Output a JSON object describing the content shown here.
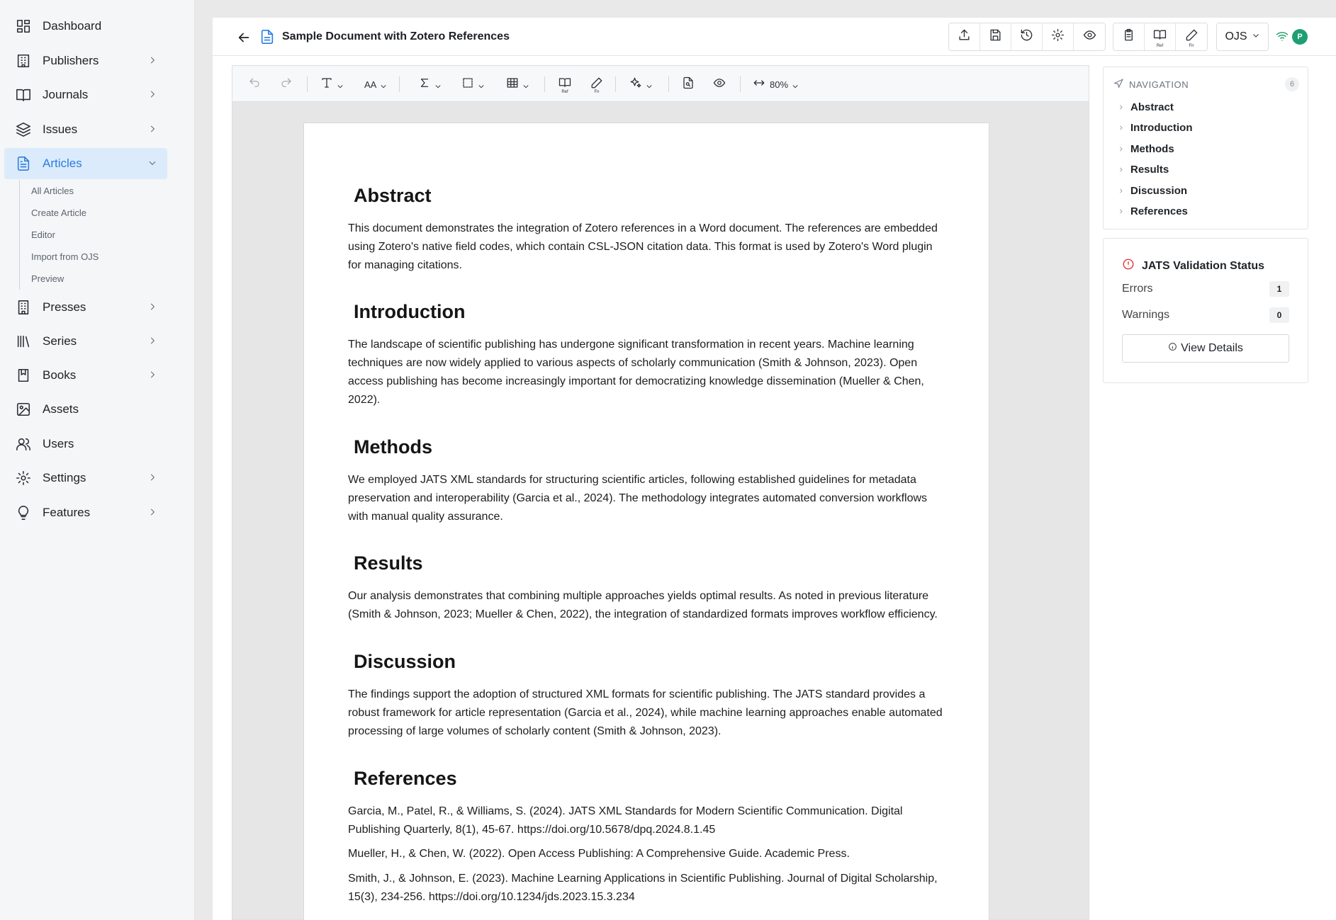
{
  "sidebar": {
    "items": [
      {
        "label": "Dashboard",
        "icon": "dashboard-icon"
      },
      {
        "label": "Publishers",
        "icon": "building-icon"
      },
      {
        "label": "Journals",
        "icon": "book-open-icon"
      },
      {
        "label": "Issues",
        "icon": "layers-icon"
      },
      {
        "label": "Articles",
        "icon": "file-text-icon"
      },
      {
        "label": "Presses",
        "icon": "office-icon"
      },
      {
        "label": "Series",
        "icon": "library-icon"
      },
      {
        "label": "Books",
        "icon": "book-icon"
      },
      {
        "label": "Assets",
        "icon": "image-icon"
      },
      {
        "label": "Users",
        "icon": "users-icon"
      },
      {
        "label": "Settings",
        "icon": "gear-icon"
      },
      {
        "label": "Features",
        "icon": "lightbulb-icon"
      }
    ],
    "articles_sub": [
      "All Articles",
      "Create Article",
      "Editor",
      "Import from OJS",
      "Preview"
    ]
  },
  "header": {
    "title": "Sample Document with Zotero References",
    "platform": "OJS",
    "avatar": "P",
    "ref_label": "Ref",
    "fn_label": "Fn"
  },
  "toolbar": {
    "ref_label": "Ref",
    "fn_label": "Fn",
    "font_size_label": "AA",
    "zoom": "80%"
  },
  "document": {
    "sections": [
      {
        "heading": "Abstract",
        "body": "This document demonstrates the integration of Zotero references in a Word document. The references are embedded using Zotero's native field codes, which contain CSL-JSON citation data. This format is used by Zotero's Word plugin for managing citations."
      },
      {
        "heading": "Introduction",
        "body": "The landscape of scientific publishing has undergone significant transformation in recent years. Machine learning techniques are now widely applied to various aspects of scholarly communication (Smith & Johnson, 2023). Open access publishing has become increasingly important for democratizing knowledge dissemination (Mueller & Chen, 2022)."
      },
      {
        "heading": "Methods",
        "body": "We employed JATS XML standards for structuring scientific articles, following established guidelines for metadata preservation and interoperability (Garcia et al., 2024). The methodology integrates automated conversion workflows with manual quality assurance."
      },
      {
        "heading": "Results",
        "body": "Our analysis demonstrates that combining multiple approaches yields optimal results. As noted in previous literature (Smith & Johnson, 2023; Mueller & Chen, 2022), the integration of standardized formats improves workflow efficiency."
      },
      {
        "heading": "Discussion",
        "body": "The findings support the adoption of structured XML formats for scientific publishing. The JATS standard provides a robust framework for article representation (Garcia et al., 2024), while machine learning approaches enable automated processing of large volumes of scholarly content (Smith & Johnson, 2023)."
      }
    ],
    "references_heading": "References",
    "references": [
      "Garcia, M., Patel, R., & Williams, S. (2024). JATS XML Standards for Modern Scientific Communication. Digital Publishing Quarterly, 8(1), 45-67. https://doi.org/10.5678/dpq.2024.8.1.45",
      "Mueller, H., & Chen, W. (2022). Open Access Publishing: A Comprehensive Guide. Academic Press.",
      "Smith, J., & Johnson, E. (2023). Machine Learning Applications in Scientific Publishing. Journal of Digital Scholarship, 15(3), 234-256. https://doi.org/10.1234/jds.2023.15.3.234"
    ]
  },
  "navigation": {
    "title": "NAVIGATION",
    "count": "6",
    "items": [
      "Abstract",
      "Introduction",
      "Methods",
      "Results",
      "Discussion",
      "References"
    ]
  },
  "validation": {
    "title": "JATS Validation Status",
    "errors_label": "Errors",
    "errors": "1",
    "warnings_label": "Warnings",
    "warnings": "0",
    "button": "View Details"
  },
  "colors": {
    "accent": "#2b7de1",
    "active_bg": "#dcebfb",
    "error": "#e03131",
    "online": "#22a06b"
  }
}
